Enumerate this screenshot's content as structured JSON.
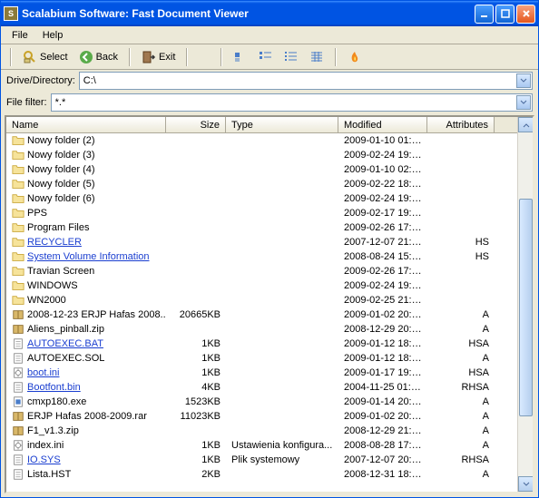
{
  "title": "Scalabium Software: Fast Document Viewer",
  "menu": {
    "file": "File",
    "help": "Help"
  },
  "toolbar": {
    "select": "Select",
    "back": "Back",
    "exit": "Exit"
  },
  "drive_label": "Drive/Directory:",
  "drive_value": "C:\\",
  "filter_label": "File filter:",
  "filter_value": "*.*",
  "columns": {
    "name": "Name",
    "size": "Size",
    "type": "Type",
    "modified": "Modified",
    "attributes": "Attributes"
  },
  "rows": [
    {
      "name": "Nowy folder (2)",
      "size": "",
      "type": "",
      "mod": "2009-01-10 01:2...",
      "attr": "",
      "icon": "folder",
      "special": false
    },
    {
      "name": "Nowy folder (3)",
      "size": "",
      "type": "",
      "mod": "2009-02-24 19:2...",
      "attr": "",
      "icon": "folder",
      "special": false
    },
    {
      "name": "Nowy folder (4)",
      "size": "",
      "type": "",
      "mod": "2009-01-10 02:0...",
      "attr": "",
      "icon": "folder",
      "special": false
    },
    {
      "name": "Nowy folder (5)",
      "size": "",
      "type": "",
      "mod": "2009-02-22 18:1...",
      "attr": "",
      "icon": "folder",
      "special": false
    },
    {
      "name": "Nowy folder (6)",
      "size": "",
      "type": "",
      "mod": "2009-02-24 19:1...",
      "attr": "",
      "icon": "folder",
      "special": false
    },
    {
      "name": "PPS",
      "size": "",
      "type": "",
      "mod": "2009-02-17 19:0...",
      "attr": "",
      "icon": "folder",
      "special": false
    },
    {
      "name": "Program Files",
      "size": "",
      "type": "",
      "mod": "2009-02-26 17:5...",
      "attr": "",
      "icon": "folder",
      "special": false
    },
    {
      "name": "RECYCLER",
      "size": "",
      "type": "",
      "mod": "2007-12-07 21:2...",
      "attr": "HS",
      "icon": "folder",
      "special": true
    },
    {
      "name": "System Volume Information",
      "size": "",
      "type": "",
      "mod": "2008-08-24 15:1...",
      "attr": "HS",
      "icon": "folder",
      "special": true
    },
    {
      "name": "Travian Screen",
      "size": "",
      "type": "",
      "mod": "2009-02-26 17:3...",
      "attr": "",
      "icon": "folder",
      "special": false
    },
    {
      "name": "WINDOWS",
      "size": "",
      "type": "",
      "mod": "2009-02-24 19:3...",
      "attr": "",
      "icon": "folder",
      "special": false
    },
    {
      "name": "WN2000",
      "size": "",
      "type": "",
      "mod": "2009-02-25 21:4...",
      "attr": "",
      "icon": "folder",
      "special": false
    },
    {
      "name": "2008-12-23 ERJP Hafas 2008...",
      "size": "20665KB",
      "type": "",
      "mod": "2009-01-02 20:2...",
      "attr": "A",
      "icon": "archive",
      "special": false
    },
    {
      "name": "Aliens_pinball.zip",
      "size": "",
      "type": "",
      "mod": "2008-12-29 20:5...",
      "attr": "A",
      "icon": "archive",
      "special": false
    },
    {
      "name": "AUTOEXEC.BAT",
      "size": "1KB",
      "type": "",
      "mod": "2009-01-12 18:5...",
      "attr": "HSA",
      "icon": "file",
      "special": true
    },
    {
      "name": "AUTOEXEC.SOL",
      "size": "1KB",
      "type": "",
      "mod": "2009-01-12 18:1...",
      "attr": "A",
      "icon": "file",
      "special": false
    },
    {
      "name": "boot.ini",
      "size": "1KB",
      "type": "",
      "mod": "2009-01-17 19:0...",
      "attr": "HSA",
      "icon": "ini",
      "special": true
    },
    {
      "name": "Bootfont.bin",
      "size": "4KB",
      "type": "",
      "mod": "2004-11-25 01:0...",
      "attr": "RHSA",
      "icon": "file",
      "special": true
    },
    {
      "name": "cmxp180.exe",
      "size": "1523KB",
      "type": "",
      "mod": "2009-01-14 20:4...",
      "attr": "A",
      "icon": "exe",
      "special": false
    },
    {
      "name": "ERJP Hafas 2008-2009.rar",
      "size": "11023KB",
      "type": "",
      "mod": "2009-01-02 20:2...",
      "attr": "A",
      "icon": "archive",
      "special": false
    },
    {
      "name": "F1_v1.3.zip",
      "size": "",
      "type": "",
      "mod": "2008-12-29 21:0...",
      "attr": "A",
      "icon": "archive",
      "special": false
    },
    {
      "name": "index.ini",
      "size": "1KB",
      "type": "Ustawienia konfigura...",
      "mod": "2008-08-28 17:1...",
      "attr": "A",
      "icon": "ini",
      "special": false
    },
    {
      "name": "IO.SYS",
      "size": "1KB",
      "type": "Plik systemowy",
      "mod": "2007-12-07 20:2...",
      "attr": "RHSA",
      "icon": "file",
      "special": true
    },
    {
      "name": "Lista.HST",
      "size": "2KB",
      "type": "",
      "mod": "2008-12-31 18:2...",
      "attr": "A",
      "icon": "file",
      "special": false
    }
  ]
}
